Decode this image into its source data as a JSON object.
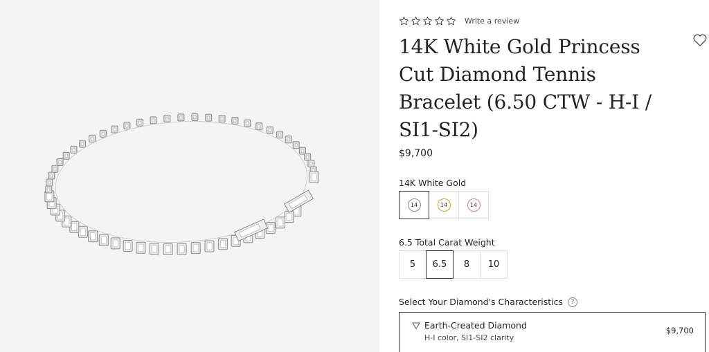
{
  "rating": {
    "stars": 5,
    "filled": 0,
    "review_link": "Write a review"
  },
  "product": {
    "title": "14K White Gold Princess Cut Diamond Tennis Bracelet (6.50 CTW - H-I / SI1-SI2)",
    "price": "$9,700"
  },
  "metal": {
    "label": "14K White Gold",
    "options": [
      {
        "text": "14",
        "color": "#8a8a8a",
        "selected": true
      },
      {
        "text": "14",
        "color": "#c9a227",
        "selected": false
      },
      {
        "text": "14",
        "color": "#e07a7a",
        "selected": false
      }
    ]
  },
  "carat": {
    "label": "6.5 Total Carat Weight",
    "options": [
      "5",
      "6.5",
      "8",
      "10"
    ],
    "selected": "6.5"
  },
  "characteristics": {
    "label": "Select Your Diamond's Characteristics",
    "help": "?",
    "diamond_title": "Earth-Created Diamond",
    "diamond_sub": "H-I color, SI1-SI2 clarity",
    "diamond_price": "$9,700"
  },
  "colors": {
    "accent": "#333333",
    "image_bg": "#f4f4f4"
  }
}
